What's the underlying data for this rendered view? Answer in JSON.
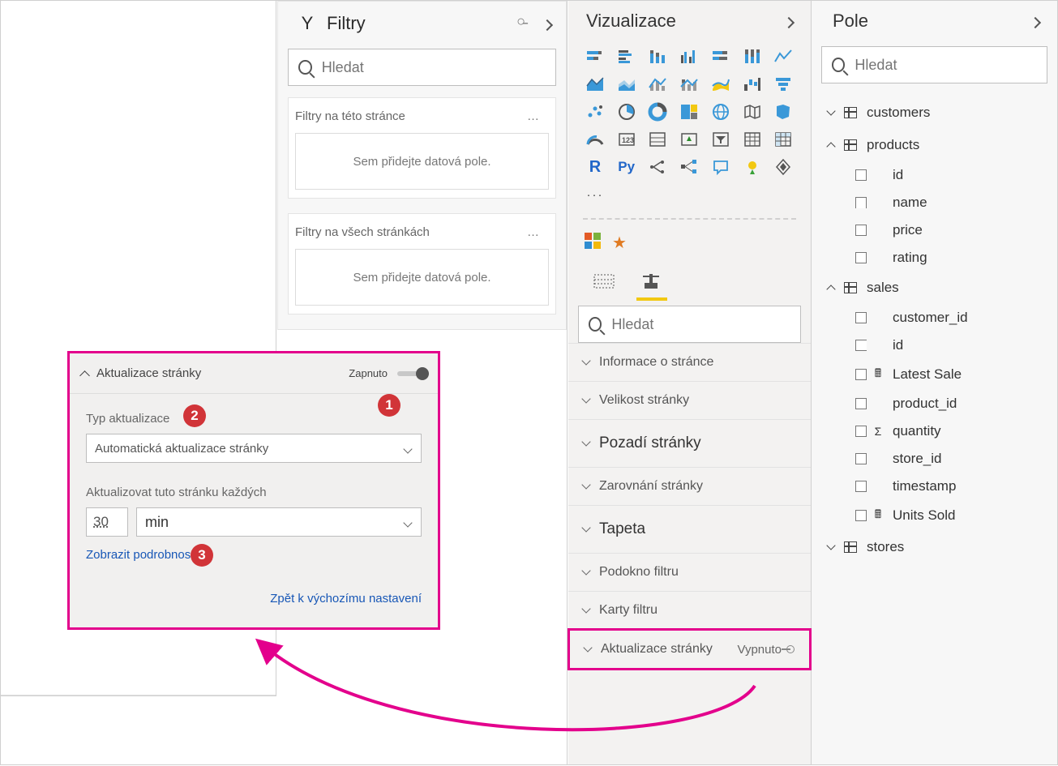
{
  "filters": {
    "title": "Filtry",
    "search_placeholder": "Hledat",
    "block1_title": "Filtry na této stránce",
    "block2_title": "Filtry na všech stránkách",
    "dropzone_text": "Sem přidejte datová pole."
  },
  "viz": {
    "title": "Vizualizace",
    "search_placeholder": "Hledat",
    "sections": {
      "page_info": "Informace o stránce",
      "page_size": "Velikost stránky",
      "page_bg": "Pozadí stránky",
      "page_align": "Zarovnání stránky",
      "wallpaper": "Tapeta",
      "filter_pane": "Podokno filtru",
      "filter_cards": "Karty filtru",
      "page_refresh": "Aktualizace stránky",
      "page_refresh_state": "Vypnuto"
    }
  },
  "fields": {
    "title": "Pole",
    "search_placeholder": "Hledat",
    "tables": {
      "customers": "customers",
      "products": "products",
      "sales": "sales",
      "stores": "stores"
    },
    "product_fields": {
      "id": "id",
      "name": "name",
      "price": "price",
      "rating": "rating"
    },
    "sales_fields": {
      "customer_id": "customer_id",
      "id": "id",
      "latest_sale": "Latest Sale",
      "product_id": "product_id",
      "quantity": "quantity",
      "store_id": "store_id",
      "timestamp": "timestamp",
      "units_sold": "Units Sold"
    }
  },
  "callout": {
    "title": "Aktualizace stránky",
    "toggle_label": "Zapnuto",
    "type_label": "Typ aktualizace",
    "type_value": "Automatická aktualizace stránky",
    "every_label": "Aktualizovat tuto stránku každých",
    "every_num": "30",
    "every_unit": "min",
    "details_link": "Zobrazit podrobnosti",
    "reset_link": "Zpět k výchozímu nastavení"
  },
  "badges": {
    "b1": "1",
    "b2": "2",
    "b3": "3"
  }
}
